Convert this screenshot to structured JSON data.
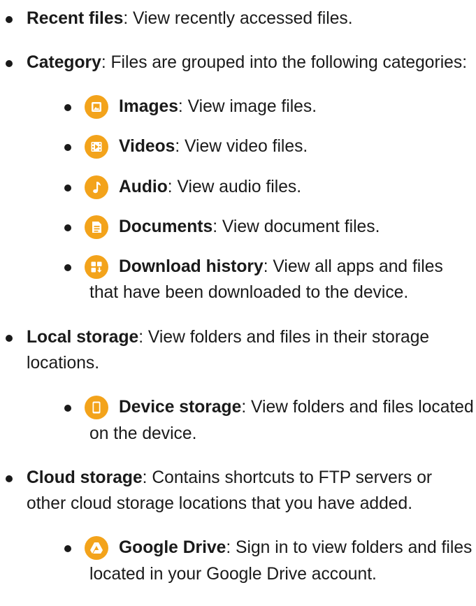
{
  "items": {
    "recent": {
      "term": "Recent files",
      "desc": ": View recently accessed files."
    },
    "category": {
      "term": "Category",
      "desc": ": Files are grouped into the following categories:",
      "children": {
        "images": {
          "term": "Images",
          "desc": ": View image files.",
          "icon": "image-icon"
        },
        "videos": {
          "term": "Videos",
          "desc": ": View video files.",
          "icon": "video-icon"
        },
        "audio": {
          "term": "Audio",
          "desc": ": View audio files.",
          "icon": "music-note-icon"
        },
        "documents": {
          "term": "Documents",
          "desc": ": View document files.",
          "icon": "document-icon"
        },
        "downloads": {
          "term": "Download history",
          "desc": ": View all apps and files that have been downloaded to the device.",
          "icon": "download-history-icon"
        }
      }
    },
    "local": {
      "term": "Local storage",
      "desc": ": View folders and files in their storage locations.",
      "children": {
        "device": {
          "term": "Device storage",
          "desc": ": View folders and files located on the device.",
          "icon": "device-icon"
        }
      }
    },
    "cloud": {
      "term": "Cloud storage",
      "desc": ": Contains shortcuts to FTP servers or other cloud storage locations that you have added.",
      "children": {
        "gdrive": {
          "term": "Google Drive",
          "desc": ": Sign in to view folders and files located in your Google Drive account.",
          "icon": "google-drive-icon"
        }
      }
    }
  },
  "colors": {
    "icon_orange": "#f3a31b",
    "text": "#1a1a1a"
  }
}
